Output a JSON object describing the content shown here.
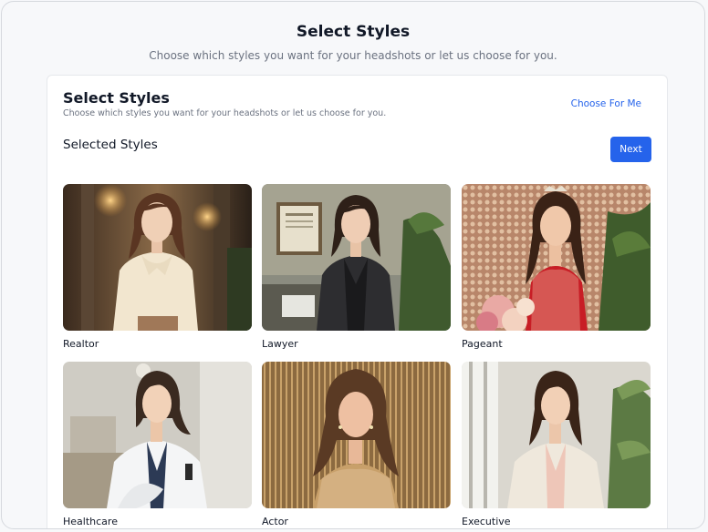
{
  "header": {
    "title": "Select Styles",
    "subtitle": "Choose which styles you want for your headshots or let us choose for you."
  },
  "card": {
    "title": "Select Styles",
    "subtitle": "Choose which styles you want for your headshots or let us choose for you.",
    "choose_for_me": "Choose For Me",
    "selected_styles_label": "Selected Styles",
    "next_label": "Next"
  },
  "styles": [
    {
      "label": "Realtor"
    },
    {
      "label": "Lawyer"
    },
    {
      "label": "Pageant"
    },
    {
      "label": "Healthcare"
    },
    {
      "label": "Actor"
    },
    {
      "label": "Executive"
    }
  ],
  "colors": {
    "accent": "#2563eb",
    "background": "#f7f8fa",
    "card": "#ffffff"
  }
}
